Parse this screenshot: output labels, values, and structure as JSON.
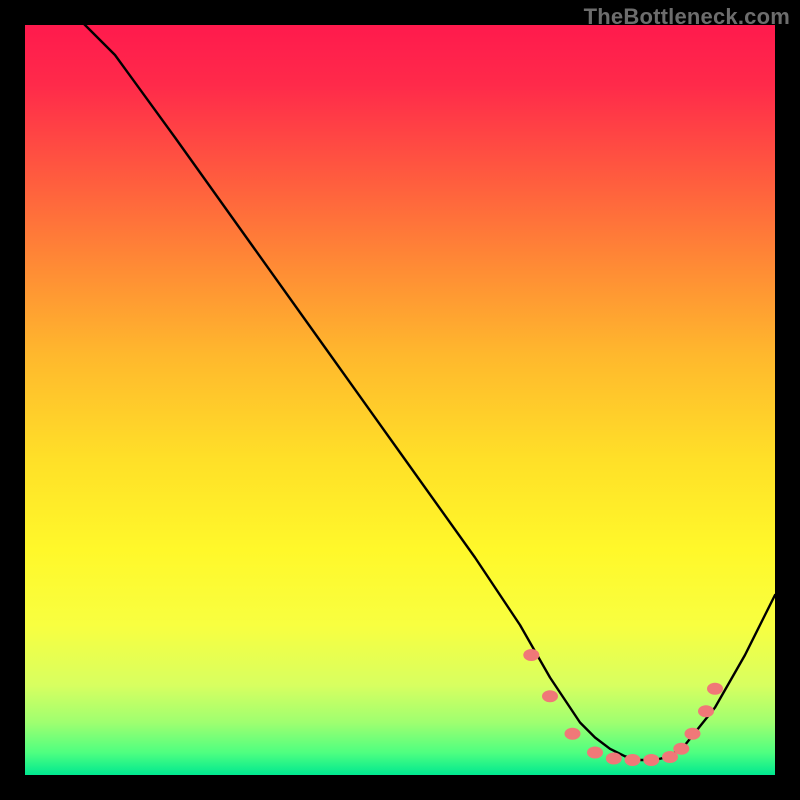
{
  "watermark": "TheBottleneck.com",
  "chart_data": {
    "type": "line",
    "title": "",
    "xlabel": "",
    "ylabel": "",
    "xlim": [
      0,
      100
    ],
    "ylim": [
      0,
      100
    ],
    "grid": false,
    "legend": false,
    "series": [
      {
        "name": "bottleneck-curve",
        "x": [
          0,
          6,
          12,
          20,
          30,
          40,
          50,
          60,
          66,
          70,
          72,
          74,
          76,
          78,
          80,
          82,
          84,
          86,
          88,
          92,
          96,
          100
        ],
        "values": [
          110,
          102,
          96,
          85,
          71,
          57,
          43,
          29,
          20,
          13,
          10,
          7,
          5,
          3.5,
          2.5,
          2,
          2,
          2.5,
          4,
          9,
          16,
          24
        ]
      }
    ],
    "markers": [
      {
        "x": 67.5,
        "y": 16
      },
      {
        "x": 70.0,
        "y": 10.5
      },
      {
        "x": 73.0,
        "y": 5.5
      },
      {
        "x": 76.0,
        "y": 3.0
      },
      {
        "x": 78.5,
        "y": 2.2
      },
      {
        "x": 81.0,
        "y": 2.0
      },
      {
        "x": 83.5,
        "y": 2.0
      },
      {
        "x": 86.0,
        "y": 2.4
      },
      {
        "x": 87.5,
        "y": 3.5
      },
      {
        "x": 89.0,
        "y": 5.5
      },
      {
        "x": 90.8,
        "y": 8.5
      },
      {
        "x": 92.0,
        "y": 11.5
      }
    ],
    "marker_color": "#f07878",
    "line_color": "#000000"
  }
}
